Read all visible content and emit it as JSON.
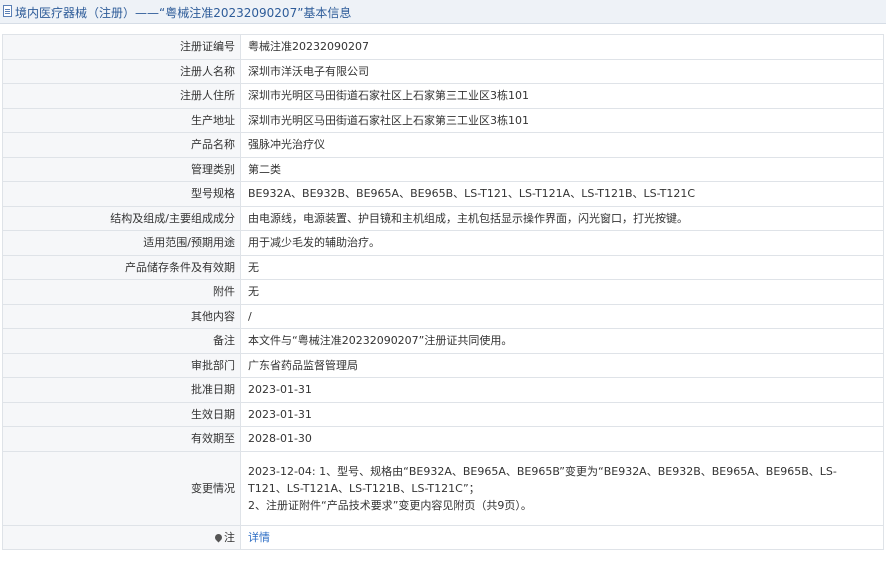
{
  "header": {
    "title": "境内医疗器械（注册）——“粤械注准20232090207”基本信息"
  },
  "rows": [
    {
      "label": "注册证编号",
      "value": "粤械注准20232090207"
    },
    {
      "label": "注册人名称",
      "value": "深圳市洋沃电子有限公司"
    },
    {
      "label": "注册人住所",
      "value": "深圳市光明区马田街道石家社区上石家第三工业区3栋101"
    },
    {
      "label": "生产地址",
      "value": "深圳市光明区马田街道石家社区上石家第三工业区3栋101"
    },
    {
      "label": "产品名称",
      "value": "强脉冲光治疗仪"
    },
    {
      "label": "管理类别",
      "value": "第二类"
    },
    {
      "label": "型号规格",
      "value": "BE932A、BE932B、BE965A、BE965B、LS-T121、LS-T121A、LS-T121B、LS-T121C"
    },
    {
      "label": "结构及组成/主要组成成分",
      "value": "由电源线，电源装置、护目镜和主机组成，主机包括显示操作界面，闪光窗口，打光按键。"
    },
    {
      "label": "适用范围/预期用途",
      "value": "用于减少毛发的辅助治疗。"
    },
    {
      "label": "产品储存条件及有效期",
      "value": "无"
    },
    {
      "label": "附件",
      "value": "无"
    },
    {
      "label": "其他内容",
      "value": "/"
    },
    {
      "label": "备注",
      "value": "本文件与“粤械注准20232090207”注册证共同使用。"
    },
    {
      "label": "审批部门",
      "value": "广东省药品监督管理局"
    },
    {
      "label": "批准日期",
      "value": "2023-01-31"
    },
    {
      "label": "生效日期",
      "value": "2023-01-31"
    },
    {
      "label": "有效期至",
      "value": "2028-01-30"
    }
  ],
  "change": {
    "label": "变更情况",
    "line1": "2023-12-04: 1、型号、规格由“BE932A、BE965A、BE965B”变更为“BE932A、BE932B、BE965A、BE965B、LS-T121、LS-T121A、LS-T121B、LS-T121C”；",
    "line2": "2、注册证附件“产品技术要求”变更内容见附页（共9页）。"
  },
  "note": {
    "label": "注",
    "link": "详情"
  }
}
